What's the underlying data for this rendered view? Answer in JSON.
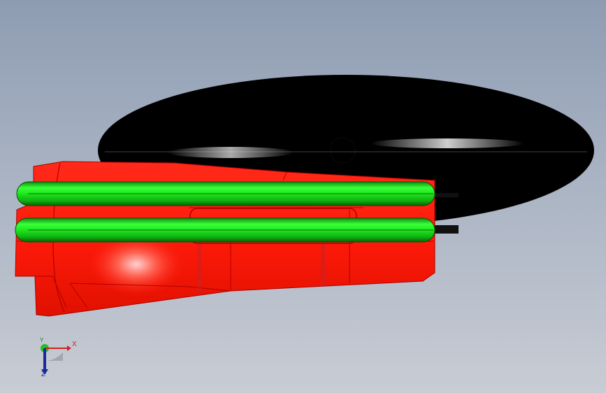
{
  "viewport": {
    "background_top": "#8e9cb2",
    "background_bottom": "#c8ccd4"
  },
  "model": {
    "body_color": "#ff1a0a",
    "rail_color": "#22ee22",
    "disc_color": "#000000"
  },
  "triad": {
    "x_label": "X",
    "y_label": "Y",
    "z_label": "Z",
    "x_color": "#d42020",
    "y_color": "#1a7a1a",
    "z_color": "#1a2a9a"
  }
}
